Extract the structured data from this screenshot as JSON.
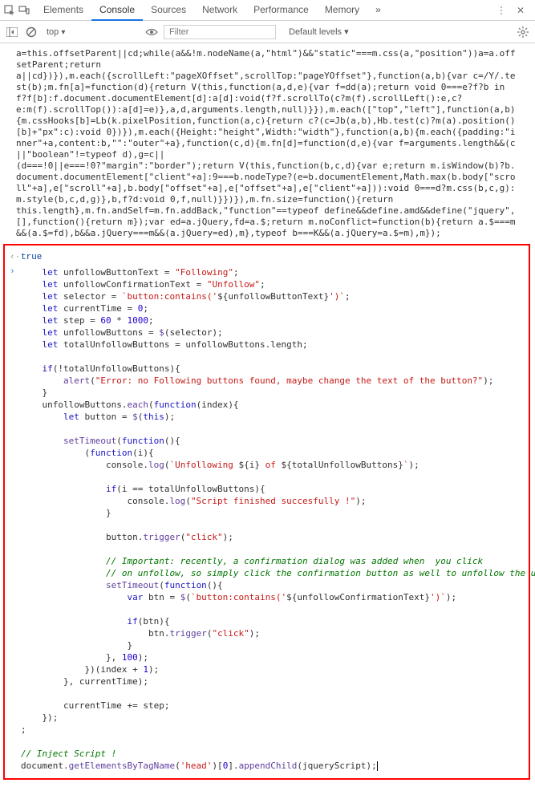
{
  "header": {
    "tabs": [
      "Elements",
      "Console",
      "Sources",
      "Network",
      "Performance",
      "Memory"
    ],
    "activeTab": "Console",
    "moreIndicator": "»"
  },
  "toolbar": {
    "context": "top",
    "filterPlaceholder": "Filter",
    "levels": "Default levels ▾"
  },
  "minifiedCode": "a=this.offsetParent||cd;while(a&&!m.nodeName(a,\"html\")&&\"static\"===m.css(a,\"position\"))a=a.offsetParent;return\na||cd})}),m.each({scrollLeft:\"pageXOffset\",scrollTop:\"pageYOffset\"},function(a,b){var c=/Y/.test(b);m.fn[a]=function(d){return V(this,function(a,d,e){var f=dd(a);return void 0===e?f?b in f?f[b]:f.document.documentElement[d]:a[d]:void(f?f.scrollTo(c?m(f).scrollLeft():e,c?\ne:m(f).scrollTop()):a[d]=e)},a,d,arguments.length,null)}}),m.each([\"top\",\"left\"],function(a,b){m.cssHooks[b]=Lb(k.pixelPosition,function(a,c){return c?(c=Jb(a,b),Hb.test(c)?m(a).position()[b]+\"px\":c):void 0})}),m.each({Height:\"height\",Width:\"width\"},function(a,b){m.each({padding:\"inner\"+a,content:b,\"\":\"outer\"+a},function(c,d){m.fn[d]=function(d,e){var f=arguments.length&&(c||\"boolean\"!=typeof d),g=c||\n(d===!0||e===!0?\"margin\":\"border\");return V(this,function(b,c,d){var e;return m.isWindow(b)?b.document.documentElement[\"client\"+a]:9===b.nodeType?(e=b.documentElement,Math.max(b.body[\"scroll\"+a],e[\"scroll\"+a],b.body[\"offset\"+a],e[\"offset\"+a],e[\"client\"+a])):void 0===d?m.css(b,c,g):m.style(b,c,d,g)},b,f?d:void 0,f,null)}})}),m.fn.size=function(){return\nthis.length},m.fn.andSelf=m.fn.addBack,\"function\"==typeof define&&define.amd&&define(\"jquery\",[],function(){return m});var ed=a.jQuery,fd=a.$;return m.noConflict=function(b){return a.$===m&&(a.$=fd),b&&a.jQuery===m&&(a.jQuery=ed),m},typeof b===K&&(a.jQuery=a.$=m),m});",
  "resultLine": {
    "arrow": "‹·",
    "value": "true"
  },
  "inputArrow": "›",
  "code": {
    "l1_let": "let",
    "l1_var": "unfollowButtonText",
    "l1_eq": " = ",
    "l1_str": "\"Following\"",
    "l1_end": ";",
    "l2_let": "let",
    "l2_var": "unfollowConfirmationText",
    "l2_eq": " = ",
    "l2_str": "\"Unfollow\"",
    "l2_end": ";",
    "l3_let": "let",
    "l3_var": "selector",
    "l3_eq": " = ",
    "l3_str1": "`button:contains('",
    "l3_tpl": "${",
    "l3_tplvar": "unfollowButtonText",
    "l3_tplend": "}",
    "l3_str2": "')`",
    "l3_end": ";",
    "l4_let": "let",
    "l4_var": "currentTime",
    "l4_eq": " = ",
    "l4_num": "0",
    "l4_end": ";",
    "l5_let": "let",
    "l5_var": "step",
    "l5_eq": " = ",
    "l5_num1": "60",
    "l5_op": " * ",
    "l5_num2": "1000",
    "l5_end": ";",
    "l6_let": "let",
    "l6_var": "unfollowButtons",
    "l6_eq": " = ",
    "l6_fn": "$",
    "l6_paren": "(selector);",
    "l7_let": "let",
    "l7_var": "totalUnfollowButtons",
    "l7_eq": " = unfollowButtons.",
    "l7_prop": "length",
    "l7_end": ";",
    "l9_if": "if",
    "l9_cond": "(!totalUnfollowButtons){",
    "l10_fn": "alert",
    "l10_open": "(",
    "l10_str": "\"Error: no Following buttons found, maybe change the text of the button?\"",
    "l10_close": ");",
    "l11_close": "}",
    "l12_obj": "unfollowButtons.",
    "l12_method": "each",
    "l12_open": "(",
    "l12_func": "function",
    "l12_args": "(index){",
    "l13_let": "let",
    "l13_var": " button = ",
    "l13_fn": "$",
    "l13_open": "(",
    "l13_this": "this",
    "l13_close": ");",
    "l15_fn": "setTimeout",
    "l15_open": "(",
    "l15_func": "function",
    "l15_args": "(){",
    "l16_open": "(",
    "l16_func": "function",
    "l16_args": "(i){",
    "l17_obj": "console.",
    "l17_method": "log",
    "l17_open": "(",
    "l17_str1": "`Unfollowing ",
    "l17_tpl1": "${",
    "l17_v1": "i",
    "l17_t1e": "}",
    "l17_mid": " of ",
    "l17_tpl2": "${",
    "l17_v2": "totalUnfollowButtons",
    "l17_t2e": "}",
    "l17_str2": "`",
    "l17_close": ");",
    "l19_if": "if",
    "l19_cond": "(i == totalUnfollowButtons){",
    "l20_obj": "console.",
    "l20_method": "log",
    "l20_open": "(",
    "l20_str": "\"Script finished succesfully !\"",
    "l20_close": ");",
    "l21_close": "}",
    "l23_obj": "button.",
    "l23_method": "trigger",
    "l23_open": "(",
    "l23_str": "\"click\"",
    "l23_close": ");",
    "l25_comment": "// Important: recently, a confirmation dialog was added when  you click",
    "l26_comment": "// on unfollow, so simply click the confirmation button as well to unfollow the user",
    "l27_fn": "setTimeout",
    "l27_open": "(",
    "l27_func": "function",
    "l27_args": "(){",
    "l28_var": "var",
    "l28_name": " btn = ",
    "l28_fn": "$",
    "l28_open": "(",
    "l28_str1": "`button:contains('",
    "l28_tpl": "${",
    "l28_tplvar": "unfollowConfirmationText",
    "l28_tple": "}",
    "l28_str2": "')`",
    "l28_close": ");",
    "l30_if": "if",
    "l30_cond": "(btn){",
    "l31_obj": "btn.",
    "l31_method": "trigger",
    "l31_open": "(",
    "l31_str": "\"click\"",
    "l31_close": ");",
    "l32_close": "}",
    "l33_close": "}, ",
    "l33_num": "100",
    "l33_end": ");",
    "l34_close": "})(index + ",
    "l34_num": "1",
    "l34_end": ");",
    "l35_close": "}, currentTime);",
    "l37_stmt": "currentTime += step;",
    "l38_close": "});",
    "l39_semi": ";",
    "l41_comment": "// Inject Script !",
    "l42_stmt": "document.",
    "l42_method": "getElementsByTagName",
    "l42_open": "(",
    "l42_str": "'head'",
    "l42_mid": ")[",
    "l42_num": "0",
    "l42_rest": "].",
    "l42_method2": "appendChild",
    "l42_open2": "(jqueryScript);"
  }
}
